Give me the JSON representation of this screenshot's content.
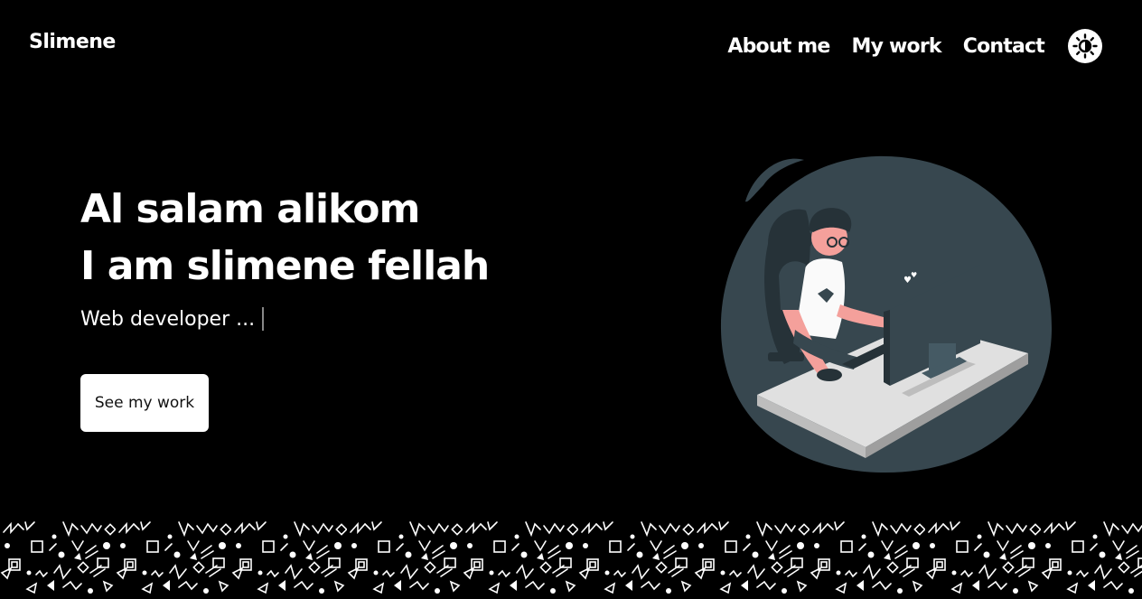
{
  "header": {
    "logo": "Slimene",
    "nav": [
      {
        "label": "About me"
      },
      {
        "label": "My work"
      },
      {
        "label": "Contact"
      }
    ],
    "theme_toggle_icon": "sun-icon"
  },
  "hero": {
    "greeting": "Al salam alikom",
    "intro": "I am slimene fellah",
    "role": "Web developer ...",
    "cta_label": "See my work"
  },
  "illustration": {
    "icon": "developer-at-computer-illustration",
    "colors": {
      "blob": "#37474f",
      "skin": "#f4a09b",
      "desk": "#e0e0e0"
    }
  },
  "footer": {
    "pattern_icon": "doodle-pattern"
  }
}
